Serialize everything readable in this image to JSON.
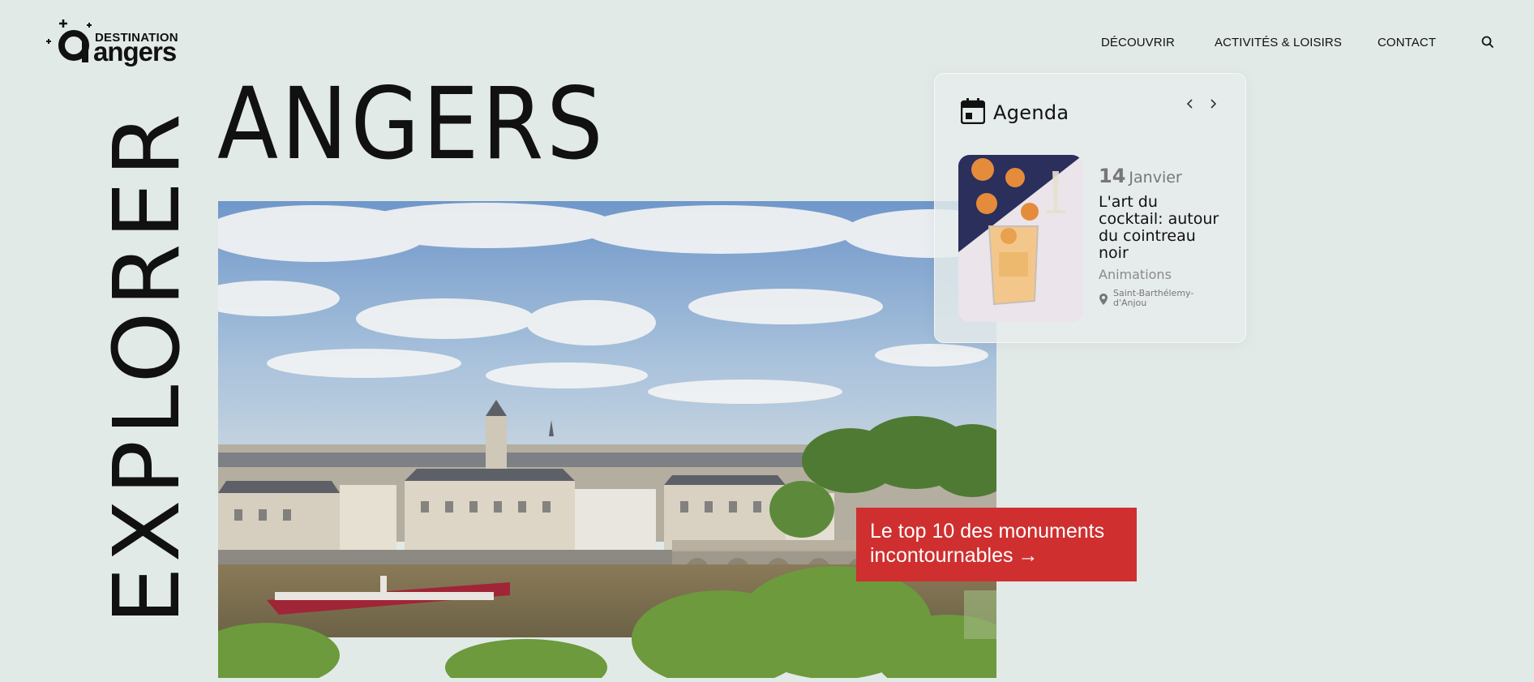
{
  "header": {
    "logo_top": "DESTINATION",
    "logo_main": "angers",
    "nav": [
      {
        "label": "DÉCOUVRIR"
      },
      {
        "label": "ACTIVITÉS & LOISIRS"
      },
      {
        "label": "CONTACT"
      }
    ],
    "search_icon": "search-icon"
  },
  "hero": {
    "title": "ANGERS",
    "vertical_title": "EXPLORER",
    "cta": "Le top 10 des monuments incontournables",
    "cta_arrow": "→",
    "cta_color": "#cf2f2f"
  },
  "agenda": {
    "title": "Agenda",
    "icon": "calendar-icon",
    "prev_icon": "chevron-left-icon",
    "next_icon": "chevron-right-icon",
    "event": {
      "day": "14",
      "month": "Janvier",
      "title": "L'art du cocktail: autour du cointreau noir",
      "category": "Animations",
      "location": "Saint-Barthélemy-d'Anjou"
    }
  },
  "colors": {
    "background": "#e2eae8",
    "accent": "#cf2f2f"
  }
}
